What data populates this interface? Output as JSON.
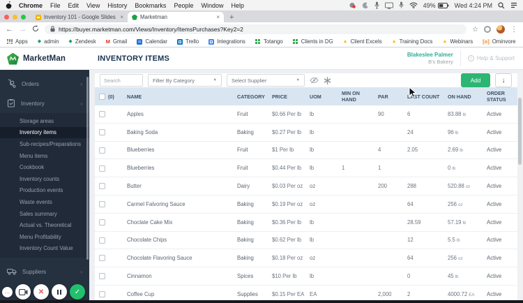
{
  "os_menubar": {
    "app_name": "Chrome",
    "menus": [
      "File",
      "Edit",
      "View",
      "History",
      "Bookmarks",
      "People",
      "Window",
      "Help"
    ],
    "battery": "49%",
    "clock": "Wed 4:24 PM"
  },
  "browser": {
    "tabs": [
      {
        "title": "Inventory 101 - Google Slides",
        "close": "×"
      },
      {
        "title": "Marketman",
        "close": "×"
      }
    ],
    "new_tab": "+",
    "url": "https://buyer.marketman.com/Views/Inventory/ItemsPurchases?Key2=2",
    "bookmarks": [
      {
        "label": "Apps",
        "icon": "grid",
        "color": "#5f6368"
      },
      {
        "label": "admin",
        "icon": "pin",
        "color": "#19a463"
      },
      {
        "label": "Zendesk",
        "icon": "pin",
        "color": "#19a463"
      },
      {
        "label": "Gmail",
        "icon": "letter",
        "glyph": "M",
        "color": "#d93025"
      },
      {
        "label": "Calendar",
        "icon": "calendar",
        "glyph": "31",
        "color": "#1a73e8"
      },
      {
        "label": "Trello",
        "icon": "square",
        "color": "#0079bf"
      },
      {
        "label": "Integrations",
        "icon": "square",
        "color": "#4285f4"
      },
      {
        "label": "Totango",
        "icon": "dots",
        "color": "#34a853"
      },
      {
        "label": "Clients in DG",
        "icon": "dots",
        "color": "#34a853"
      },
      {
        "label": "Client Excels",
        "icon": "drive",
        "color": "#fbbc05"
      },
      {
        "label": "Training Docs",
        "icon": "drive",
        "color": "#fbbc05"
      },
      {
        "label": "Webinars",
        "icon": "drive",
        "color": "#fbbc05"
      },
      {
        "label": "Ominvore",
        "icon": "letter",
        "glyph": "[o]",
        "color": "#f6821f"
      }
    ]
  },
  "app": {
    "brand": "MarketMan",
    "sidebar": {
      "parents": [
        {
          "label": "Orders",
          "icon": "hand-truck"
        },
        {
          "label": "Inventory",
          "icon": "clipboard"
        }
      ],
      "chevron": "›",
      "inventory_children": [
        "Storage areas",
        "Inventory items",
        "Sub-recipes/Preparations",
        "Menu items",
        "Cookbook",
        "Inventory counts",
        "Production events",
        "Waste events",
        "Sales summary",
        "Actual vs. Theoretical",
        "Menu Profitability",
        "Inventory Count Value"
      ],
      "active_child": "Inventory items",
      "suppliers_label": "Suppliers"
    },
    "header": {
      "title": "INVENTORY ITEMS",
      "user_name": "Blakeslee Palmer",
      "account": "B's Bakery",
      "help_label": "Help & Support",
      "help_glyph": "i"
    },
    "toolbar": {
      "search_placeholder": "Search",
      "category_dropdown": "Filter By Category",
      "supplier_dropdown": "Select Supplier",
      "add_button": "Add",
      "download_glyph": "↓"
    },
    "table": {
      "select_count": "(0)",
      "columns": [
        "NAME",
        "CATEGORY",
        "PRICE",
        "UOM",
        "MIN ON HAND",
        "PAR",
        "LAST COUNT",
        "ON HAND",
        "ORDER STATUS"
      ],
      "rows": [
        {
          "name": "Apples",
          "category": "Fruit",
          "price": "$0.66 Per lb",
          "uom": "lb",
          "min_on_hand": "",
          "par": "90",
          "last_count": "6",
          "on_hand": "83.88",
          "on_hand_unit": "lb",
          "order_status": "Active"
        },
        {
          "name": "Baking Soda",
          "category": "Baking",
          "price": "$0.27 Per lb",
          "uom": "lb",
          "min_on_hand": "",
          "par": "",
          "last_count": "24",
          "on_hand": "96",
          "on_hand_unit": "lb",
          "order_status": "Active"
        },
        {
          "name": "Blueberries",
          "category": "Fruit",
          "price": "$1 Per lb",
          "uom": "lb",
          "min_on_hand": "",
          "par": "4",
          "last_count": "2.05",
          "on_hand": "2.69",
          "on_hand_unit": "lb",
          "order_status": "Active"
        },
        {
          "name": "Blueberries",
          "category": "Fruit",
          "price": "$0.44 Per lb",
          "uom": "lb",
          "min_on_hand": "1",
          "par": "1",
          "last_count": "",
          "on_hand": "0",
          "on_hand_unit": "lb",
          "order_status": "Active"
        },
        {
          "name": "Butter",
          "category": "Dairy",
          "price": "$0.03 Per oz",
          "uom": "oz",
          "min_on_hand": "",
          "par": "200",
          "last_count": "288",
          "on_hand": "520.88",
          "on_hand_unit": "oz",
          "order_status": "Active"
        },
        {
          "name": "Carmel Falvoring Sauce",
          "category": "Baking",
          "price": "$0.19 Per oz",
          "uom": "oz",
          "min_on_hand": "",
          "par": "",
          "last_count": "64",
          "on_hand": "256",
          "on_hand_unit": "oz",
          "order_status": "Active"
        },
        {
          "name": "Choclate Cake Mix",
          "category": "Baking",
          "price": "$0.36 Per lb",
          "uom": "lb",
          "min_on_hand": "",
          "par": "",
          "last_count": "28.59",
          "on_hand": "57.19",
          "on_hand_unit": "lb",
          "order_status": "Active"
        },
        {
          "name": "Chocolate Chips",
          "category": "Baking",
          "price": "$0.62 Per lb",
          "uom": "lb",
          "min_on_hand": "",
          "par": "",
          "last_count": "12",
          "on_hand": "5.5",
          "on_hand_unit": "lb",
          "order_status": "Active"
        },
        {
          "name": "Chocolate Flavoring Sauce",
          "category": "Baking",
          "price": "$0.18 Per oz",
          "uom": "oz",
          "min_on_hand": "",
          "par": "",
          "last_count": "64",
          "on_hand": "256",
          "on_hand_unit": "oz",
          "order_status": "Active"
        },
        {
          "name": "Cinnamon",
          "category": "Spices",
          "price": "$10 Per lb",
          "uom": "lb",
          "min_on_hand": "",
          "par": "",
          "last_count": "0",
          "on_hand": "45",
          "on_hand_unit": "lb",
          "order_status": "Active"
        },
        {
          "name": "Coffee Cup",
          "category": "Supplies",
          "price": "$0.15 Per EA",
          "uom": "EA",
          "min_on_hand": "",
          "par": "2,000",
          "last_count": "2",
          "on_hand": "4000.72",
          "on_hand_unit": "EA",
          "order_status": "Active"
        }
      ]
    }
  },
  "recorder": {
    "more": "...",
    "buttons": [
      "more-options",
      "camera",
      "cancel",
      "pause",
      "finish"
    ]
  },
  "colors": {
    "accent_green": "#2bb673",
    "sidebar_bg": "#263140",
    "table_header_bg": "#d9e6f2",
    "brand_teal": "#2fae93"
  }
}
